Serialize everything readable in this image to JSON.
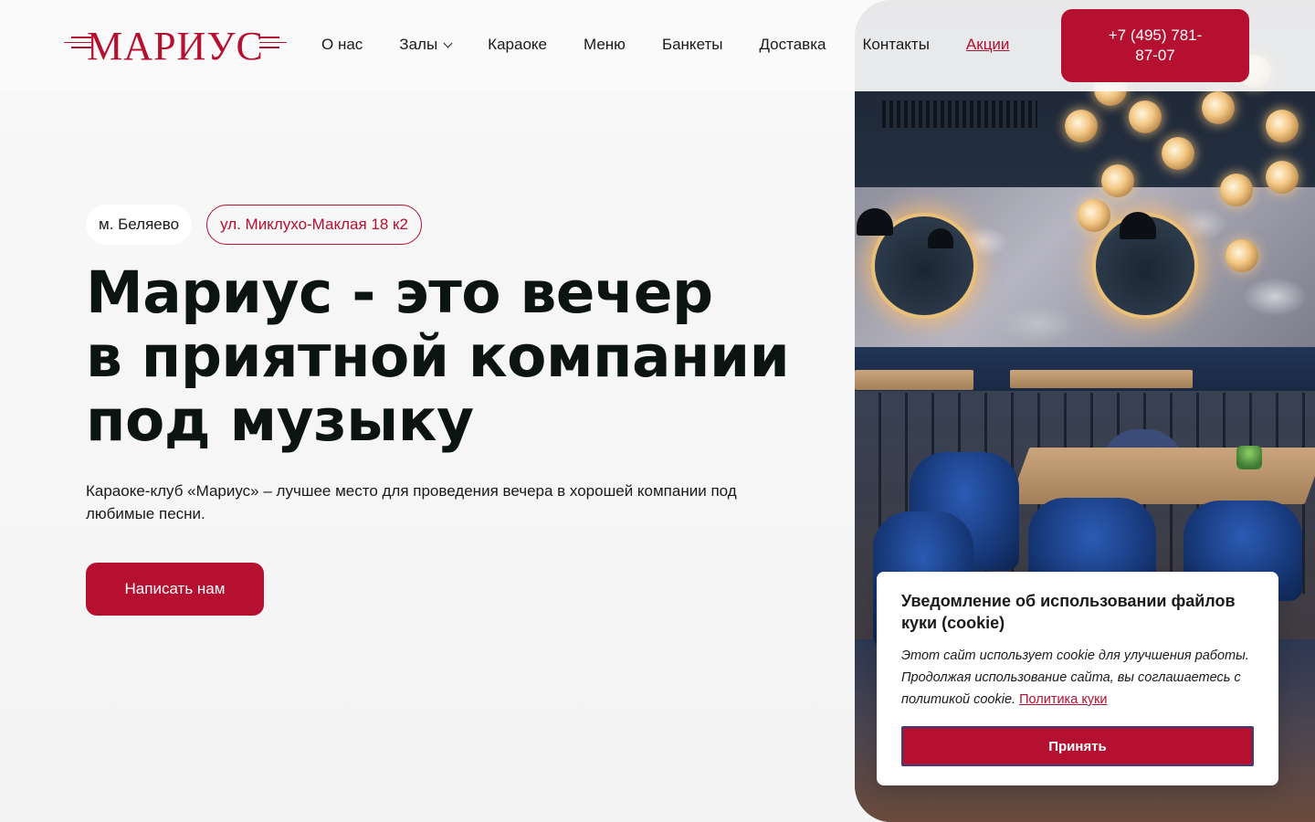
{
  "colors": {
    "accent": "#b5102f",
    "text": "#0e1512",
    "background": "#f5f5f5"
  },
  "brand": {
    "logo_text": "МАРИУС"
  },
  "nav": {
    "items": [
      {
        "label": "О нас"
      },
      {
        "label": "Залы",
        "has_dropdown": true
      },
      {
        "label": "Караоке"
      },
      {
        "label": "Меню"
      },
      {
        "label": "Банкеты"
      },
      {
        "label": "Доставка"
      },
      {
        "label": "Контакты"
      },
      {
        "label": "Акции",
        "active": true
      }
    ]
  },
  "header": {
    "phone": "+7 (495) 781-87-07"
  },
  "hero": {
    "metro": "м. Беляево",
    "address": "ул. Миклухо-Маклая 18 к2",
    "title_lines": [
      "Мариус - это вечер",
      "в приятной компании",
      "под музыку"
    ],
    "subtitle": "Караоке-клуб «Мариус» – лучшее место для проведения вечера в хорошей компании под любимые песни.",
    "cta_label": "Написать нам",
    "photo_icon": "restaurant-interior-photo"
  },
  "cookie": {
    "title": "Уведомление об использовании файлов куки (cookie)",
    "text": "Этот сайт использует cookie для улучшения работы. Продолжая использование сайта, вы соглашаетесь с политикой cookie.",
    "link_label": "Политика куки",
    "accept_label": "Принять"
  }
}
